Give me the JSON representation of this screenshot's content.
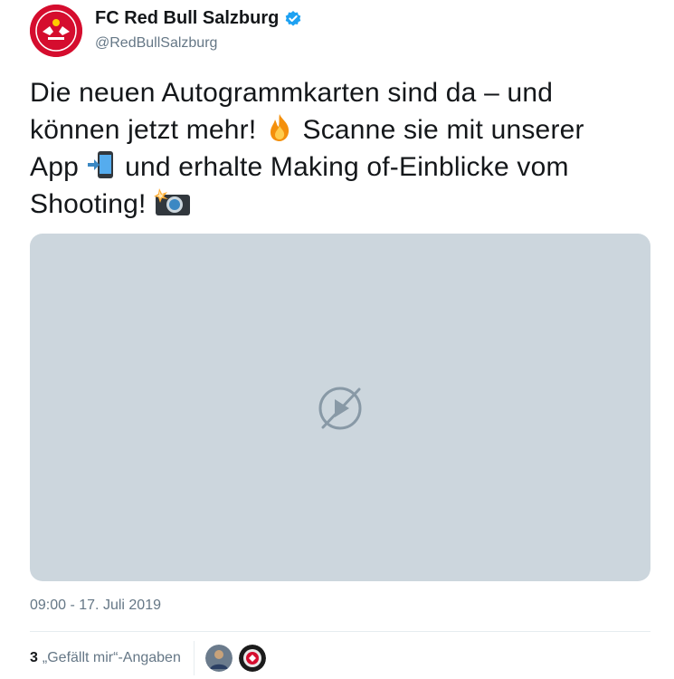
{
  "account": {
    "display_name": "FC Red Bull Salzburg",
    "handle": "@RedBullSalzburg",
    "verified": true
  },
  "tweet": {
    "line1": "Die neuen Autogrammkarten sind da – und",
    "line2a": "können jetzt mehr!",
    "line2b": "Scanne sie mit unserer",
    "line3a": "App",
    "line3b": "und erhalte Making of-Einblicke vom",
    "line4a": "Shooting!",
    "emojis": [
      "fire-emoji",
      "mobile-arrow-emoji",
      "camera-flash-emoji"
    ]
  },
  "media": {
    "state": "unavailable",
    "icon": "play-disabled-icon"
  },
  "meta": {
    "timestamp": "09:00 - 17. Juli 2019",
    "likes_count": "3",
    "likes_label": "„Gefällt mir“-Angaben"
  },
  "colors": {
    "text": "#14171a",
    "muted": "#657786",
    "media_bg": "#ccd6dd",
    "verified": "#1da1f2",
    "brand_red": "#d50d2e"
  }
}
